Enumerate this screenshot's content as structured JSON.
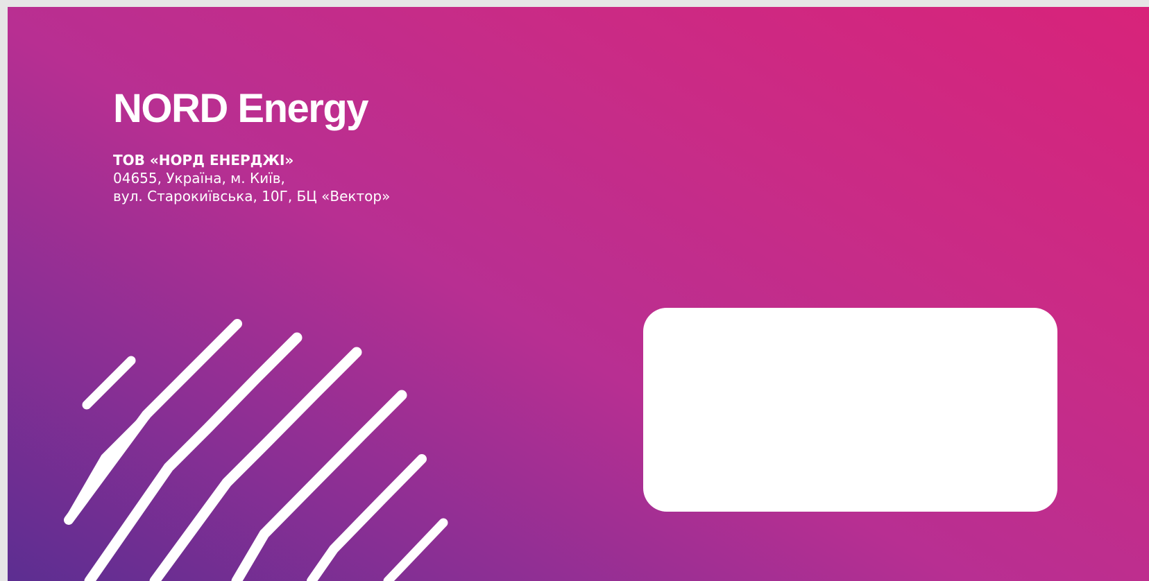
{
  "brand": {
    "name": "NORD Energy"
  },
  "sender": {
    "company": "ТОВ «НОРД ЕНЕРДЖІ»",
    "address_line_1": "04655, Україна, м. Київ,",
    "address_line_2": "вул. Старокиївська, 10Г, БЦ «Вектор»"
  },
  "colors": {
    "gradient_start": "#5c2e91",
    "gradient_mid": "#b82f92",
    "gradient_end": "#d8237a",
    "text": "#ffffff"
  }
}
